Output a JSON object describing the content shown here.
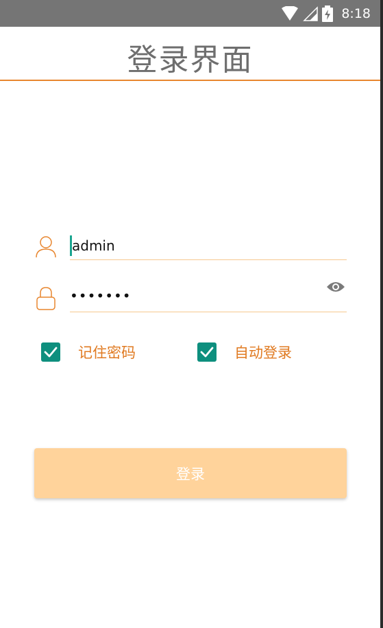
{
  "status_bar": {
    "time": "8:18",
    "icons": [
      "wifi-icon",
      "signal-icon",
      "battery-charging-icon"
    ]
  },
  "header": {
    "title": "登录界面"
  },
  "form": {
    "username": {
      "value": "admin",
      "icon": "user-icon"
    },
    "password": {
      "masked_value": "•••••••",
      "icon": "lock-icon",
      "toggle_icon": "eye-icon"
    },
    "remember_password": {
      "label": "记住密码",
      "checked": true
    },
    "auto_login": {
      "label": "自动登录",
      "checked": true
    },
    "login_button": {
      "label": "登录"
    }
  },
  "colors": {
    "accent": "#e8862f",
    "input_underline": "#f7c88f",
    "checkbox": "#0e8f7e",
    "checkbox_label": "#e07a21",
    "button_bg": "#ffd39b",
    "status_bar": "#757575",
    "cursor": "#1aa590"
  }
}
